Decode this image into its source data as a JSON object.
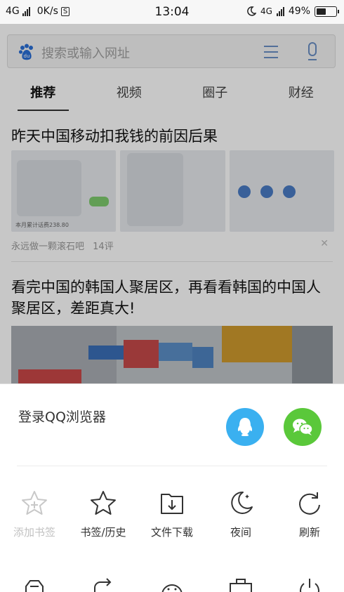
{
  "status_bar": {
    "network_type": "4G",
    "speed": "0K/s",
    "s_badge": "S",
    "time": "13:04",
    "network_type_right": "4G",
    "battery": "49%"
  },
  "browser": {
    "search_placeholder": "搜索或输入网址",
    "tabs": [
      {
        "label": "推荐"
      },
      {
        "label": "视频"
      },
      {
        "label": "圈子"
      },
      {
        "label": "财经"
      }
    ],
    "article1": {
      "title": "昨天中国移动扣我钱的前因后果",
      "thumb1_caption": "本月累计话费238.80",
      "source": "永远做一颗滚石吧",
      "comments": "14评"
    },
    "article2": {
      "title": "看完中国的韩国人聚居区，再看看韩国的中国人聚居区，差距真大!"
    }
  },
  "sheet": {
    "login_text": "登录QQ浏览器",
    "qq_color": "#3ab0f0",
    "wechat_color": "#5ac83a",
    "row1": [
      {
        "label": "添加书签",
        "icon": "star-plus-icon"
      },
      {
        "label": "书签/历史",
        "icon": "star-icon"
      },
      {
        "label": "文件下载",
        "icon": "download-icon"
      },
      {
        "label": "夜间",
        "icon": "moon-icon"
      },
      {
        "label": "刷新",
        "icon": "refresh-icon"
      }
    ],
    "row2": [
      {
        "icon": "toolbox-icon"
      },
      {
        "icon": "share-icon"
      },
      {
        "icon": "face-icon"
      },
      {
        "icon": "briefcase-icon"
      },
      {
        "icon": "power-icon"
      }
    ]
  }
}
